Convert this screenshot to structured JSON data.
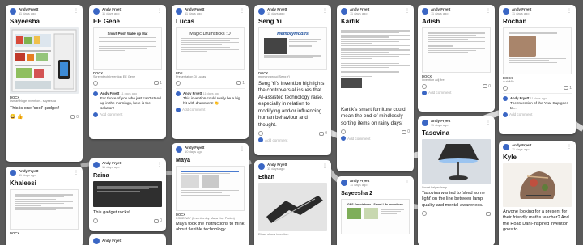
{
  "author": "Andy Fryett",
  "time": "11 days ago",
  "time_short": "10 days ago",
  "add_comment": "Add comment",
  "cards": {
    "sayeesha": {
      "title": "Sayeesha",
      "file_tag": "DOCX",
      "file_name": "#smartfridge invention - sayeesha",
      "body": "This is one 'cool' gadget!",
      "comment_count": "0"
    },
    "eegene": {
      "title": "EE Gene",
      "doc_title": "Smart Push Wake up Mat",
      "file_tag": "DOCX",
      "file_name": "Screentech Invention EE Gene",
      "comment_count": "1",
      "comment_author": "Andy Fryett",
      "comment_time": "11 days ago",
      "comment_text": "For those of you who just can't stand up in the mornings, here is the solution!"
    },
    "lucas": {
      "title": "Lucas",
      "doc_title": "Magic Drumsticks :D",
      "file_tag": "PDF",
      "file_name": "Presentation Di Lucas",
      "comment_count": "1",
      "comment_author": "Andy Fryett",
      "comment_time": "11 days ago",
      "comment_text": "This invention could really be a big hit with drummers! 👏"
    },
    "sengyi": {
      "title": "Seng Yi",
      "doc_title": "MemoryModifs",
      "file_tag": "DOCX",
      "file_name": "memory proud Seng Yi",
      "body": "Seng Yi's invention highlights the controversial issues that AI-assisted technology raise, especially in relation to modifying and/or influencing human behaviour and thought.",
      "comment_count": "0"
    },
    "kartik": {
      "title": "Kartik",
      "body": "Kartik's smart furniture could mean the end of mindlessly sorting items on rainy days!",
      "comment_count": "0"
    },
    "adish": {
      "title": "Adish",
      "file_tag": "DOCX",
      "file_name": "invention adj fire",
      "comment_count": "0"
    },
    "rochan": {
      "title": "Rochan",
      "file_tag": "DOCX",
      "file_name": "AutoMix",
      "comment_count": "1",
      "comment_author": "Andy Fryett",
      "comment_time": "11 days ago",
      "comment_text": "The Invention of the Year Cup goes to..."
    },
    "khaleesi": {
      "title": "Khaleesi",
      "file_tag": "DOCX"
    },
    "raina": {
      "title": "Raina",
      "body": "This gadget rocks!",
      "comment_count": "0"
    },
    "maya": {
      "title": "Maya",
      "file_tag": "DOCX",
      "file_name": "FORDWAY (Invention by Maya Kay Paden)",
      "body": "Maya took the instructions to think about flexible technology"
    },
    "ethan": {
      "title": "Ethan",
      "file_name": "Ethan shoes invention"
    },
    "sayeesha2": {
      "title": "Sayeesha 2",
      "doc_title": "GPS Smartshoes - Smart Life Inventions"
    },
    "tasovina": {
      "title": "Tasovina",
      "file_name": "Smart helper lamp",
      "body": "Tasovina wanted to 'shed some light' on the line between lamp quality and mental awareness."
    },
    "kyle": {
      "title": "Kyle",
      "body": "Anyone looking for a present for their friendly maths teacher? And the Road Dahl-inspired invention goes to..."
    }
  }
}
